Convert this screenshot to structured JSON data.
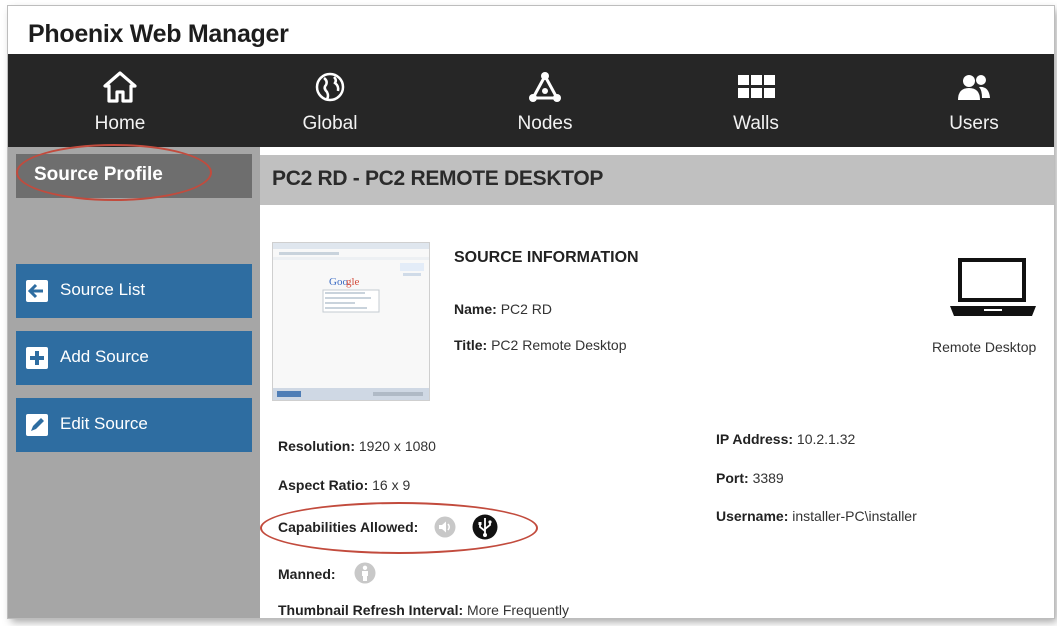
{
  "app": {
    "title": "Phoenix Web Manager"
  },
  "nav": {
    "items": [
      {
        "label": "Home",
        "icon": "home-icon"
      },
      {
        "label": "Global",
        "icon": "globe-icon"
      },
      {
        "label": "Nodes",
        "icon": "nodes-icon"
      },
      {
        "label": "Walls",
        "icon": "grid-icon"
      },
      {
        "label": "Users",
        "icon": "users-icon"
      }
    ]
  },
  "sidebar": {
    "title": "Source Profile",
    "buttons": [
      {
        "label": "Source List",
        "icon": "arrow-left-icon"
      },
      {
        "label": "Add Source",
        "icon": "plus-icon"
      },
      {
        "label": "Edit Source",
        "icon": "pencil-icon"
      }
    ]
  },
  "main": {
    "title": "PC2 RD - PC2 REMOTE DESKTOP",
    "section_title": "SOURCE INFORMATION",
    "name_label": "Name:",
    "name_value": "PC2 RD",
    "title_label": "Title:",
    "title_value": "PC2 Remote Desktop",
    "source_type": "Remote Desktop",
    "resolution_label": "Resolution:",
    "resolution_value": "1920 x 1080",
    "aspect_label": "Aspect Ratio:",
    "aspect_value": "16 x 9",
    "capabilities_label": "Capabilities Allowed:",
    "manned_label": "Manned:",
    "thumbnail_label": "Thumbnail Refresh Interval:",
    "thumbnail_value": "More Frequently",
    "ip_label": "IP Address:",
    "ip_value": "10.2.1.32",
    "port_label": "Port:",
    "port_value": "3389",
    "username_label": "Username:",
    "username_value": "installer-PC\\installer"
  },
  "colors": {
    "navbar": "#262626",
    "sidebar": "#a6a6a6",
    "sidebar_title": "#6e6e6e",
    "button": "#2e6da1",
    "header": "#c0c0c0",
    "highlight": "#c24b3d"
  }
}
